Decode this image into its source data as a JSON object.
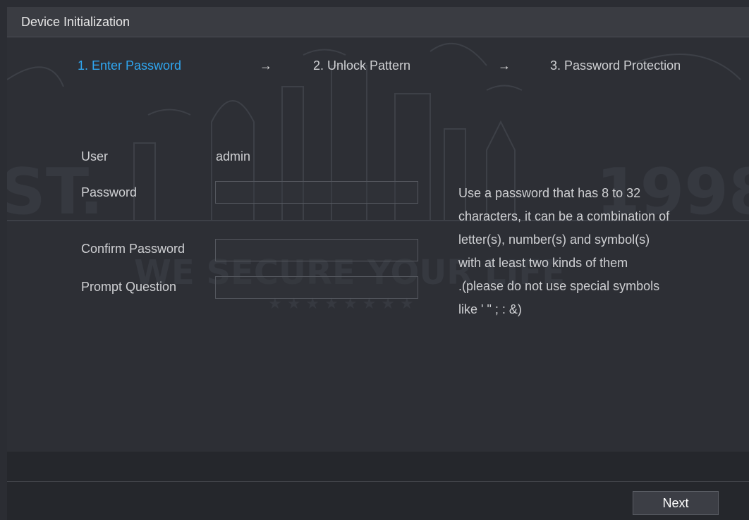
{
  "window": {
    "title": "Device Initialization"
  },
  "steps": [
    {
      "label": "1.  Enter Password",
      "active": true
    },
    {
      "label": "2.  Unlock Pattern",
      "active": false
    },
    {
      "label": "3.  Password Protection",
      "active": false
    }
  ],
  "step_arrow": "→",
  "form": {
    "user_label": "User",
    "user_value": "admin",
    "password_label": "Password",
    "password_value": "",
    "confirm_label": "Confirm Password",
    "confirm_value": "",
    "prompt_label": "Prompt Question",
    "prompt_value": ""
  },
  "hint": "Use a password that has 8 to 32\ncharacters, it can be a combination of\nletter(s), number(s) and symbol(s)\nwith at least two kinds of them\n.(please do not use special symbols\nlike ' \" ; : &)",
  "footer": {
    "next_label": "Next"
  },
  "colors": {
    "accent": "#2fa6f0",
    "background": "#2d2f35",
    "text": "#cfd0d3"
  }
}
